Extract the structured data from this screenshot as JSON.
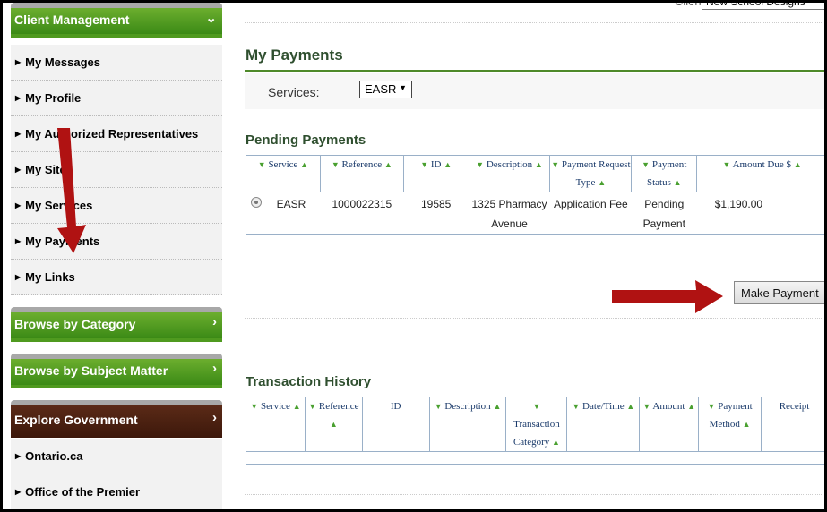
{
  "client": {
    "label": "Client:",
    "value": "New School Designs"
  },
  "sidebar": {
    "client_management": "Client Management",
    "items": [
      {
        "label": "My Messages"
      },
      {
        "label": "My Profile"
      },
      {
        "label": "My Authorized Representatives"
      },
      {
        "label": "My Sites"
      },
      {
        "label": "My Services"
      },
      {
        "label": "My Payments"
      },
      {
        "label": "My Links"
      }
    ],
    "browse_category": "Browse by Category",
    "browse_subject": "Browse by Subject Matter",
    "explore_gov": "Explore Government",
    "gov_items": [
      {
        "label": "Ontario.ca"
      },
      {
        "label": "Office of the Premier"
      }
    ]
  },
  "page": {
    "title": "My Payments",
    "services_label": "Services:",
    "services_value": "EASR",
    "pending_title": "Pending Payments",
    "pending_headers": [
      "Service",
      "Reference",
      "ID",
      "Description",
      "Payment Request Type",
      "Payment Status",
      "Amount Due $"
    ],
    "pending_row": {
      "service": "EASR",
      "reference": "1000022315",
      "id": "19585",
      "description": "1325 Pharmacy Avenue",
      "request_type": "Application Fee",
      "status": "Pending Payment",
      "amount": "$1,190.00"
    },
    "make_payment": "Make Payment",
    "history_title": "Transaction History",
    "history_headers": [
      "Service",
      "Reference",
      "ID",
      "Description",
      "Transaction Category",
      "Date/Time",
      "Amount",
      "Payment Method",
      "Receipt"
    ]
  },
  "colors": {
    "green": "#4f9a1f",
    "brown": "#3d180b",
    "arrow": "#b01212"
  }
}
